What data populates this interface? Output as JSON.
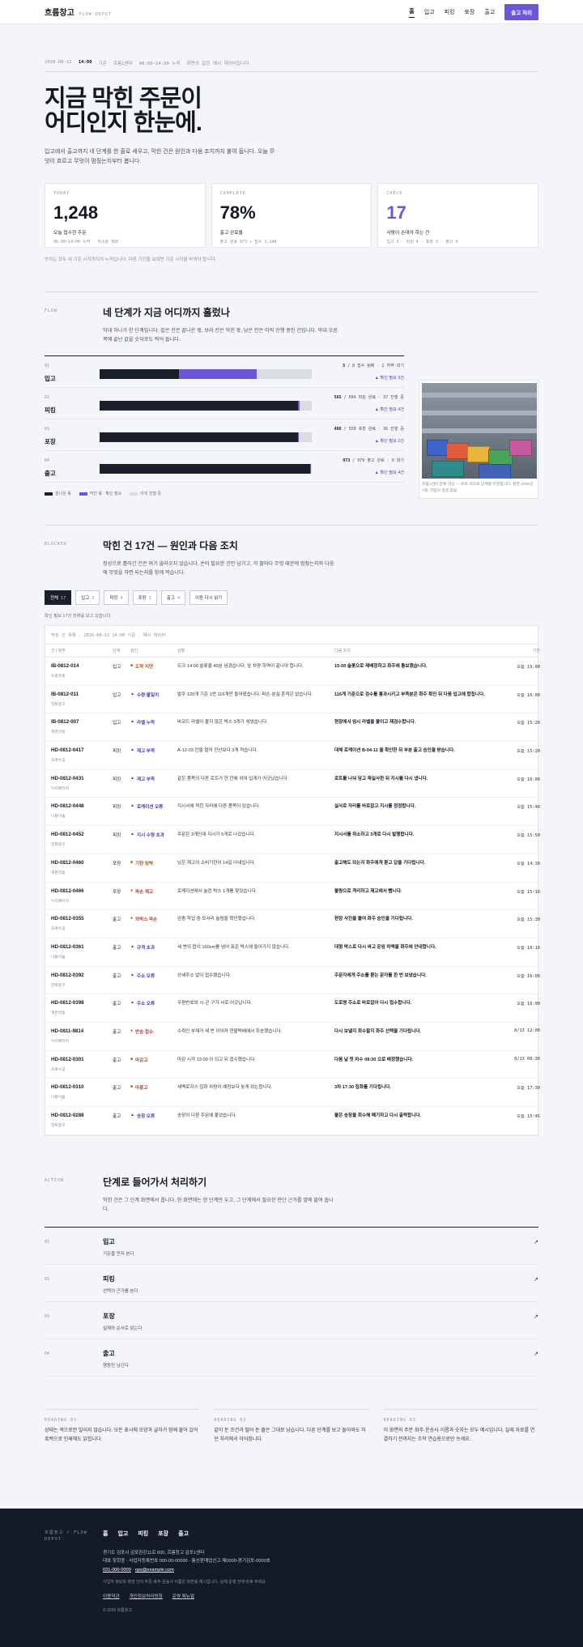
{
  "header": {
    "brand": "흐름창고",
    "brand_sub": "FLOW·DEPOT",
    "nav": [
      {
        "label": "홈"
      },
      {
        "label": "입고"
      },
      {
        "label": "피킹"
      },
      {
        "label": "포장"
      },
      {
        "label": "출고"
      }
    ],
    "cta": "출고 처리"
  },
  "hero": {
    "meta_date": "2026-08-12",
    "meta_time": "14:00",
    "meta_basis": "기준",
    "meta_center": "흐름1센터",
    "meta_hours": "06:00~14:00 누적",
    "meta_note": "화면의 값은 예시 데이터입니다",
    "title_line1": "지금 막힌 주문이",
    "title_line2": "어디인지 한눈에.",
    "desc": "입고에서 출고까지 네 단계를 한 줄로 세우고, 막힌 건은 원인과 다음 조치까지 붙여 둡니다. 오늘 무엇이 흐르고 무엇이 멈췄는지부터 봅니다."
  },
  "kpis": [
    {
      "label": "TODAY",
      "value": "1,248",
      "caption": "오늘 접수한 주문",
      "note": "06:00~14:00 누적 · 취소분 제외"
    },
    {
      "label": "COMPLETE",
      "value": "78%",
      "caption": "출고 완료율",
      "note": "출고 완료 973 ÷ 접수 1,248"
    },
    {
      "label": "CHECK",
      "value": "17",
      "caption": "사람이 손대야 하는 건",
      "note": "입고 3 · 피킹 4 · 포장 2 · 출고 4"
    }
  ],
  "kpi_foot": "숫자는 모두 위 기준 시각까지의 누적입니다. 다른 기간을 보려면 기준 시각을 바꿔야 합니다.",
  "flow": {
    "tag": "FLOW",
    "title": "네 단계가 지금 어디까지 흘렀나",
    "desc": "막대 하나가 한 단계입니다. 짙은 칸은 끝나온 몫, 보라 칸은 막힌 몫, 남은 칸은 아직 진행 중인 건입니다. 막대 오른쪽에 끝난 값을 숫자로도 적어 둡니다.",
    "stages": [
      {
        "no": "01",
        "name": "입고",
        "stats_a": "3",
        "stats_b": "/ 8 접수 팀배 · 2 하역·대기",
        "link": "▲ 확인 필요 3건",
        "done": 0.375,
        "check": 0.365
      },
      {
        "no": "02",
        "name": "피킹",
        "stats_a": "565",
        "stats_b": "/ 604 피킹 완료 · 37 진행 중",
        "link": "▲ 확인 필요 4건",
        "done": 0.935,
        "check": 0.007
      },
      {
        "no": "03",
        "name": "포장",
        "stats_a": "488",
        "stats_b": "/ 550 포장 완료 · 36 진행 중",
        "link": "▲ 확인 필요 2건",
        "done": 0.935,
        "check": 0.004
      },
      {
        "no": "04",
        "name": "출고",
        "stats_a": "973",
        "stats_b": "/ 979 출고 완료 · 0 대기",
        "link": "▲ 확인 필요 4건",
        "done": 0.994,
        "check": 0.004
      }
    ],
    "legend": [
      "끝나온 몫",
      "막힌 몫 · 확인 필요",
      "아직 진행 중"
    ],
    "photo_caption": "흐름1센터 분류 라인 — 토트 색으로 단계를 구분합니다. 촬영 2026년 7월, 작업자 얼굴 없음."
  },
  "blockers": {
    "tag": "BLOCKED",
    "title": "막힌 건 17건 — 원인과 다음 조치",
    "desc": "정상으로 흘러간 건은 여기 올라오지 않습니다. 손이 필요한 건만 남기고, 각 줄마다 무엇 때문에 멈췄는지와 다음에 무엇을 하면 되는지를 함께 적습니다.",
    "chips": [
      {
        "label": "전체",
        "n": "17"
      },
      {
        "label": "입고",
        "n": "3"
      },
      {
        "label": "피킹",
        "n": "4"
      },
      {
        "label": "포장",
        "n": "2"
      },
      {
        "label": "출고",
        "n": "4"
      },
      {
        "label": "이동 다시 읽기",
        "n": ""
      }
    ],
    "chip_note": "확인 필요 17건 전체를 보고 있습니다.",
    "table_caption": "막힌 건 목록 · 2026-08-12 14:00 기준 · 예시 데이터",
    "columns": [
      "건 / 화주",
      "단계",
      "원인",
      "상황",
      "다음 조치",
      "기한"
    ],
    "rows": [
      {
        "id": "IB-0812-014",
        "cust": "도봉유통",
        "stage": "입고",
        "mk": "■",
        "mkc": "#a0521d",
        "cause": "도착 지연",
        "detail": "도크 14:00 슬롯을 40분 넘겼습니다. 앞 차량 하역이 끝나야 합니다.",
        "action": "15:00 슬롯으로 재배정하고 화주에 통보했습니다.",
        "due": "오늘 15:00"
      },
      {
        "id": "IB-0812-011",
        "cust": "한화문구",
        "stage": "입고",
        "mk": "▲",
        "mkc": "#4b3db8",
        "cause": "수량 불일치",
        "detail": "발주 120개 기준 1번 116개만 들어왔습니다. 파손·분실 흔적은 없습니다.",
        "action": "116개 기준으로 검수를 통과시키고 부족분은 화주 확인 뒤 다음 입고에 합칩니다.",
        "due": "오늘 16:00"
      },
      {
        "id": "IB-0812-007",
        "cust": "해온리빙",
        "stage": "입고",
        "mk": "▲",
        "mkc": "#4b3db8",
        "cause": "라벨 누락",
        "detail": "바코드 라벨이 붙지 않은 박스 3개가 섞였습니다.",
        "action": "현장에서 임시 라벨을 붙이고 재검수합니다.",
        "due": "오늘 15:20"
      },
      {
        "id": "HD-0812-0417",
        "cust": "초록수공",
        "stage": "피킹",
        "mk": "▲",
        "mkc": "#4b3db8",
        "cause": "재고 부족",
        "detail": "A-12-03 칸을 열어 전산보다 3개 적습니다.",
        "action": "대체 로케이션 B-04-11 을 확인한 뒤 부분 출고 승인을 받습니다.",
        "due": "오늘 15:20"
      },
      {
        "id": "HD-0812-0431",
        "cust": "누리베이커",
        "stage": "피킹",
        "mk": "▲",
        "mkc": "#4b3db8",
        "cause": "재고 부족",
        "detail": "같은 품목의 다른 로트가 한 칸에 섞여 입게가 어긋났습니다.",
        "action": "로트를 나눠 담고 재실사한 뒤 지시를 다시 냅니다.",
        "due": "오늘 16:00"
      },
      {
        "id": "HD-0812-0448",
        "cust": "나들이숲",
        "stage": "피킹",
        "mk": "▲",
        "mkc": "#4b3db8",
        "cause": "로케이션 오류",
        "detail": "지시서에 적힌 자리에 다른 품목이 있습니다.",
        "action": "실사로 자리를 바로잡고 지시를 정정합니다.",
        "due": "오늘 15:40"
      },
      {
        "id": "HD-0812-0452",
        "cust": "한화문구",
        "stage": "피킹",
        "mk": "▲",
        "mkc": "#4b3db8",
        "cause": "지시 수량 초과",
        "detail": "주문은 3개인데 지시가 5개로 나갔습니다.",
        "action": "지시서를 취소하고 3개로 다시 발행합니다.",
        "due": "오늘 15:50"
      },
      {
        "id": "HD-0812-0460",
        "cust": "해온리빙",
        "stage": "포장",
        "mk": "■",
        "mkc": "#a0521d",
        "cause": "기한 임박",
        "detail": "남은 재고의 소비기한이 14일 이내입니다.",
        "action": "출고해도 되는지 화주에게 묻고 답을 기다립니다.",
        "due": "오늘 14:30"
      },
      {
        "id": "HD-0812-0466",
        "cust": "누리베이커",
        "stage": "포장",
        "mk": "●",
        "mkc": "#b23a3a",
        "cause": "파손 재고",
        "detail": "로케이션에서 눌린 박스 1개를 찾았습니다.",
        "action": "불량으로 격리하고 재고에서 뺍니다.",
        "due": "오늘 15:10"
      },
      {
        "id": "HD-0812-0355",
        "cust": "초록수공",
        "stage": "출고",
        "mk": "●",
        "mkc": "#b23a3a",
        "cause": "외박스 파손",
        "detail": "완충 작업 중 모서리 눌림을 확인했습니다.",
        "action": "현장 사진을 붙여 화주 승인을 기다립니다.",
        "due": "오늘 15:30"
      },
      {
        "id": "HD-0812-0361",
        "cust": "나들이숲",
        "stage": "출고",
        "mk": "▲",
        "mkc": "#4b3db8",
        "cause": "규격 초과",
        "detail": "세 변의 합이 160cm를 넘어 표준 박스에 들어가지 않습니다.",
        "action": "대형 박스로 다시 싸고 운임 차액을 화주에 안내합니다.",
        "due": "오늘 16:10"
      },
      {
        "id": "HD-0812-0392",
        "cust": "한화문구",
        "stage": "출고",
        "mk": "▲",
        "mkc": "#4b3db8",
        "cause": "주소 오류",
        "detail": "상세주소 없이 접수됐습니다.",
        "action": "주문자에게 주소를 묻는 문자를 한 번 보냈습니다.",
        "due": "오늘 16:00"
      },
      {
        "id": "HD-0812-0398",
        "cust": "해온리빙",
        "stage": "출고",
        "mk": "▲",
        "mkc": "#4b3db8",
        "cause": "주소 오류",
        "detail": "우편번호와 시·군·구가 서로 어긋납니다.",
        "action": "도로명 주소로 바로잡아 다시 접수합니다.",
        "due": "오늘 16:00"
      },
      {
        "id": "HD-0811-9814",
        "cust": "누리베이커",
        "stage": "출고",
        "mk": "●",
        "mkc": "#b23a3a",
        "cause": "반송 접수",
        "detail": "수취인 부재가 세 번 이어져 현물택배에서 회송했습니다.",
        "action": "다시 보낼지 회수할지 화주 선택을 기다립니다.",
        "due": "8/13 12:00"
      },
      {
        "id": "HD-0812-0301",
        "cust": "초록수공",
        "stage": "출고",
        "mk": "■",
        "mkc": "#a0521d",
        "cause": "마감고",
        "detail": "마감 시각 13:00 이 되고 뒤 접수했습니다.",
        "action": "다음 날 첫 차수 08:30 으로 배정했습니다.",
        "due": "8/13 08:30"
      },
      {
        "id": "HD-0812-0310",
        "cust": "나들이숲",
        "stage": "출고",
        "mk": "■",
        "mkc": "#a0521d",
        "cause": "마흥고",
        "detail": "세백로지스 집화 차량이 예정보다 늦게 와는합니다.",
        "action": "3차 17:30 집화를 기다립니다.",
        "due": "오늘 17:30"
      },
      {
        "id": "HD-0812-0288",
        "cust": "한화문구",
        "stage": "출고",
        "mk": "▲",
        "mkc": "#4b3db8",
        "cause": "송장 오류",
        "detail": "송장이 다른 주문에 붙었습니다.",
        "action": "붙은 송장을 회수해 폐기하고 다시 출력합니다.",
        "due": "오늘 15:45"
      }
    ]
  },
  "action": {
    "tag": "ACTION",
    "title": "단계로 들어가서 처리하기",
    "desc": "막힌 건은 그 단계 화면에서 풉니다. 한 화면에는 한 단계만 두고, 그 단계에서 필요한 판단 근거를 옆에 붙여 둡니다.",
    "items": [
      {
        "no": "01",
        "title": "입고",
        "sub": "기준을 먼저 본다"
      },
      {
        "no": "02",
        "title": "피킹",
        "sub": "선택의 근거를 본다"
      },
      {
        "no": "03",
        "title": "포장",
        "sub": "실제와 순서로 읽는다"
      },
      {
        "no": "04",
        "title": "출고",
        "sub": "행동만 남긴다"
      }
    ],
    "arrow": "↗"
  },
  "readings": [
    {
      "tag": "READING 01",
      "text": "상태는 색으로만 알리지 않습니다. 모든 표시에 모양과 글자가 함께 붙어 있어 흑백으로 인쇄해도 읽힙니다."
    },
    {
      "tag": "READING 02",
      "text": "같이 둔 조건과 떨어 둔 줄은 그대로 남습니다. 다른 단계를 보고 돌아와도 하던 자리에서 이어집니다."
    },
    {
      "tag": "READING 03",
      "text": "이 화면의 주문·화주·운송사·이름과 숫자는 모두 예시입니다. 실제 자료를 연결하기 전까지는 조작 연습용으로만 쓰세요."
    }
  ],
  "footer": {
    "brand": "흐름창고 / FLOW DEPOT",
    "nav": [
      "홈",
      "입고",
      "피킹",
      "포장",
      "출고"
    ],
    "address": "경기도 김포시 김포한강11로 000, 흐름창고 김포1센터",
    "business": "대표 장희윤 · 사업자등록번호 000-00-00000 · 통신판매업신고 제0000-경기김포-0000호",
    "phone": "031-000-0000",
    "email": "ops@example.com",
    "legal": "사업자 정보와 화면 안의 주문·화주·운송사 이름은 화면용 예시입니다. 실제 운영 전에 바꿔 주세요.",
    "links": [
      "이용약관",
      "개인정보처리방침",
      "운영 매뉴얼"
    ],
    "copy": "© 2026 흐름창고"
  }
}
